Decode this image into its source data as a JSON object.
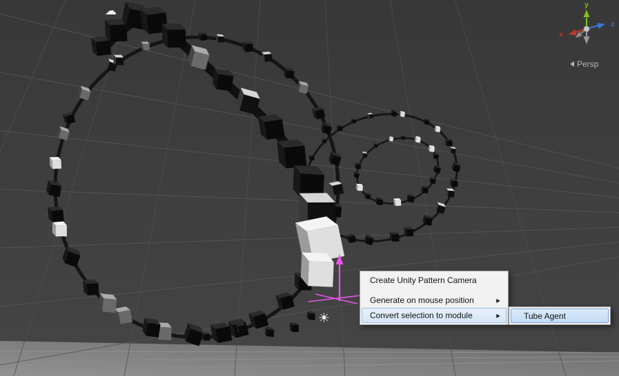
{
  "viewport": {
    "background_color": "#3d3d3d",
    "ground_color": "#7e7e7e",
    "persp_label": "Persp",
    "axis_gizmo": {
      "x_label": "x",
      "y_label": "y",
      "z_label": "z",
      "x_color": "#c0392b",
      "y_color": "#7ec11d",
      "z_color": "#3b76d6",
      "back_axis_color": "#999999"
    },
    "move_gizmo_color": "#e855e8"
  },
  "context_menu": {
    "items": [
      {
        "label": "Create Unity Pattern Camera",
        "has_submenu": false,
        "selected": false
      },
      {
        "label": "Generate on mouse position",
        "has_submenu": true,
        "selected": false
      },
      {
        "label": "Convert selection to module",
        "has_submenu": true,
        "selected": true
      }
    ],
    "submenu_arrow_glyph": "▶",
    "submenu": {
      "items": [
        {
          "label": "Tube Agent",
          "selected": true
        }
      ]
    },
    "highlight_color": "#c2dcf5"
  },
  "icons": {
    "cloud_glyph": "☁",
    "sun_glyph": "☀"
  }
}
